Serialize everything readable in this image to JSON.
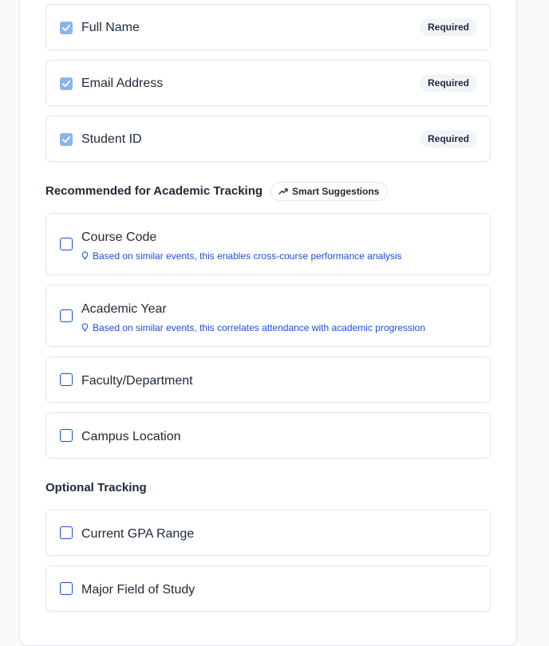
{
  "required_fields": [
    {
      "label": "Full Name",
      "badge": "Required",
      "checked": true
    },
    {
      "label": "Email Address",
      "badge": "Required",
      "checked": true
    },
    {
      "label": "Student ID",
      "badge": "Required",
      "checked": true
    }
  ],
  "recommended": {
    "heading": "Recommended for Academic Tracking",
    "smart_pill": "Smart Suggestions",
    "items": [
      {
        "label": "Course Code",
        "hint": "Based on similar events, this enables cross-course performance analysis",
        "checked": false
      },
      {
        "label": "Academic Year",
        "hint": "Based on similar events, this correlates attendance with academic progression",
        "checked": false
      },
      {
        "label": "Faculty/Department",
        "checked": false
      },
      {
        "label": "Campus Location",
        "checked": false
      }
    ]
  },
  "optional": {
    "heading": "Optional Tracking",
    "items": [
      {
        "label": "Current GPA Range",
        "checked": false
      },
      {
        "label": "Major Field of Study",
        "checked": false
      }
    ]
  },
  "colors": {
    "accent": "#1d4ed8",
    "checked_fill": "#8ab4f0",
    "border": "#e5e7eb"
  }
}
